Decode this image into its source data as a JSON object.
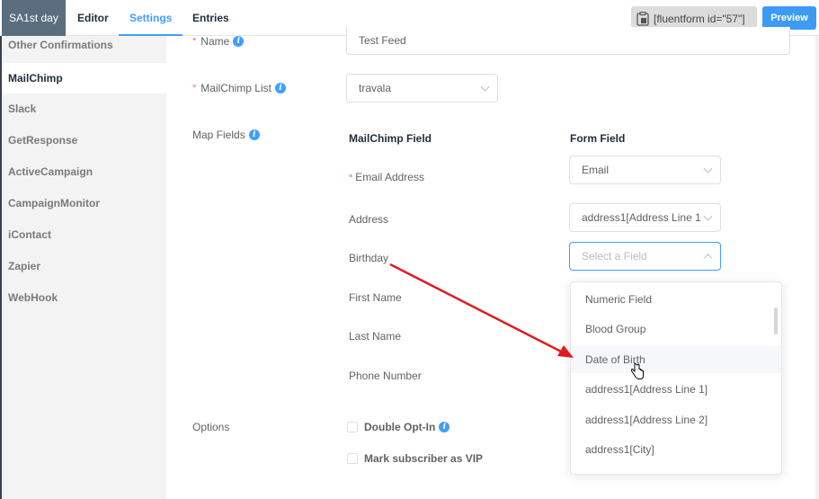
{
  "header": {
    "form_title": "SA1st day",
    "tabs": [
      {
        "label": "Editor",
        "active": false
      },
      {
        "label": "Settings",
        "active": true
      },
      {
        "label": "Entries",
        "active": false
      }
    ],
    "shortcode": "[fluentform id=\"57\"]",
    "preview_label": "Preview"
  },
  "sidebar": {
    "items": [
      {
        "label": "Other Confirmations",
        "active": false
      },
      {
        "label": "MailChimp",
        "active": true
      },
      {
        "label": "Slack",
        "active": false
      },
      {
        "label": "GetResponse",
        "active": false
      },
      {
        "label": "ActiveCampaign",
        "active": false
      },
      {
        "label": "CampaignMonitor",
        "active": false
      },
      {
        "label": "iContact",
        "active": false
      },
      {
        "label": "Zapier",
        "active": false
      },
      {
        "label": "WebHook",
        "active": false
      }
    ]
  },
  "form": {
    "name_label": "Name",
    "name_value": "Test Feed",
    "list_label": "MailChimp List",
    "list_value": "travala",
    "map_fields_label": "Map Fields",
    "col_mailchimp": "MailChimp Field",
    "col_form": "Form Field",
    "mappings": [
      {
        "field": "Email Address",
        "required": true,
        "value": "Email"
      },
      {
        "field": "Address",
        "required": false,
        "value": "address1[Address Line 1"
      },
      {
        "field": "Birthday",
        "required": false,
        "value": "",
        "placeholder": "Select a Field"
      },
      {
        "field": "First Name",
        "required": false
      },
      {
        "field": "Last Name",
        "required": false
      },
      {
        "field": "Phone Number",
        "required": false
      }
    ],
    "options_label": "Options",
    "options": [
      {
        "label": "Double Opt-In",
        "checked": false,
        "info": true
      },
      {
        "label": "Mark subscriber as VIP",
        "checked": false,
        "info": false
      }
    ]
  },
  "dropdown": {
    "items": [
      {
        "label": "Numeric Field",
        "hover": false
      },
      {
        "label": "Blood Group",
        "hover": false
      },
      {
        "label": "Date of Birth",
        "hover": true
      },
      {
        "label": "address1[Address Line 1]",
        "hover": false
      },
      {
        "label": "address1[Address Line 2]",
        "hover": false
      },
      {
        "label": "address1[City]",
        "hover": false
      }
    ]
  },
  "colors": {
    "accent": "#409eff",
    "title_bg": "#5a6e7f",
    "required": "#f56c6c",
    "annotation_arrow": "#e01b1b"
  }
}
